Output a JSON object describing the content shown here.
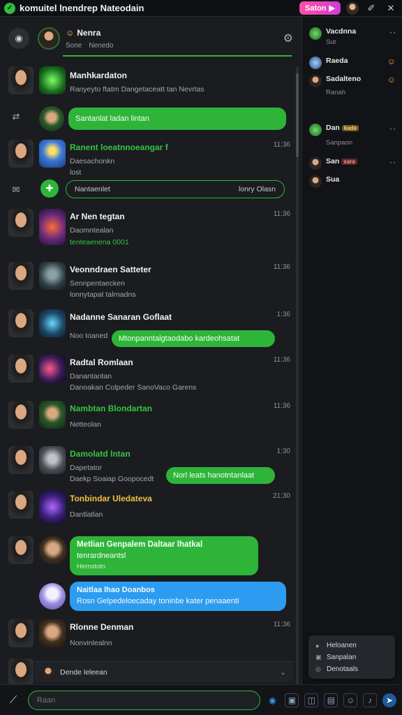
{
  "app": {
    "title": "komuitel lnendrep Nateodain",
    "top_button": "Saton",
    "logo_glyph": "✓"
  },
  "chat_header": {
    "name": "Nenra",
    "sub1": "Sone",
    "sub2": "Nenedo"
  },
  "rows": [
    {
      "name": "Manhkardaton",
      "sub": "Ranyeyto ftatm  Dangetaceatt tan  Nevrtas",
      "time": "",
      "green_name": false
    },
    {
      "bubble": "Santanlat ladan lintan"
    },
    {
      "name": "Ranent loeatnnoeangar f",
      "sub": "Daesachonkn",
      "sub2": "lost",
      "time": "11:36",
      "green_name": true
    },
    {
      "bubble_outline_left": "Nantaenlet",
      "bubble_outline_right": "lonry Olasn"
    },
    {
      "name": "Ar Nen tegtan",
      "sub": "Daomntealan",
      "sub2": "tenteaenena 0001",
      "time": "11:36",
      "green_name": false
    },
    {
      "name": "Veonndraen Satteter",
      "sub": "Sennpentaecken",
      "sub2": "lonnytapat  talrnadns",
      "time": "11:36",
      "green_name": false
    },
    {
      "name": "Nadanne Sanaran Goflaat",
      "sub": "Noo toaned",
      "bubble": "Mtonpanntalgtaodabo kardeohsatat",
      "time": "1:36",
      "green_name": false
    },
    {
      "name": "Radtal Romlaan",
      "sub": "Danantantan",
      "sub2": "Danoakan Colpeder  SanoVaco Garens",
      "time": "11:36",
      "green_name": false
    },
    {
      "name": "Nambtan Blondartan",
      "sub": "Netteolan",
      "time": "11:36",
      "green_name": true
    },
    {
      "name": "Damolatd lntan",
      "sub": "Dapetator",
      "sub2": "Daekp Soaiap Goopocedt",
      "bubble": "Norl leats hanotntanlaat",
      "time": "1:30",
      "green_name": true
    },
    {
      "name": "Tonbindar Uledateva",
      "sub": "Dantlatlan",
      "time": "21:30",
      "green_name": false
    },
    {
      "bubble_line1": "Metlian Genpalem Daltaar lhatkal",
      "bubble_line2": "tenrardneantsl",
      "bubble_line3": "Hernstotn"
    },
    {
      "blue_line1": "Naitlaa lhao Doanbos",
      "blue_line2": "Rosn Gelpedeloecaday toninbe kater penaaenti"
    },
    {
      "name": "Rlonne Denman",
      "sub": "Nonvinlealnn",
      "time": "11:36",
      "green_name": false
    }
  ],
  "composer_preview": "Dende leleean",
  "input": {
    "placeholder": "Raan"
  },
  "right_pane": {
    "items": [
      {
        "name": "Vacdnna",
        "sub": "Sut"
      },
      {
        "name": "Raeda",
        "sub": ""
      },
      {
        "name": "Sadalteno",
        "sub": "Ranah"
      },
      {
        "name": "Dan",
        "badge": "kade",
        "sub": "Sanpaon"
      },
      {
        "name": "San",
        "badge": "sara",
        "sub": ""
      },
      {
        "name": "Sua",
        "sub": ""
      }
    ]
  },
  "context_menu": {
    "items": [
      "Heloanen",
      "Sanpalan",
      "Denotaals"
    ]
  },
  "colors": {
    "accent_green": "#2fb43a",
    "accent_blue": "#2d9cf0",
    "top_button": "#ff4fa5"
  }
}
